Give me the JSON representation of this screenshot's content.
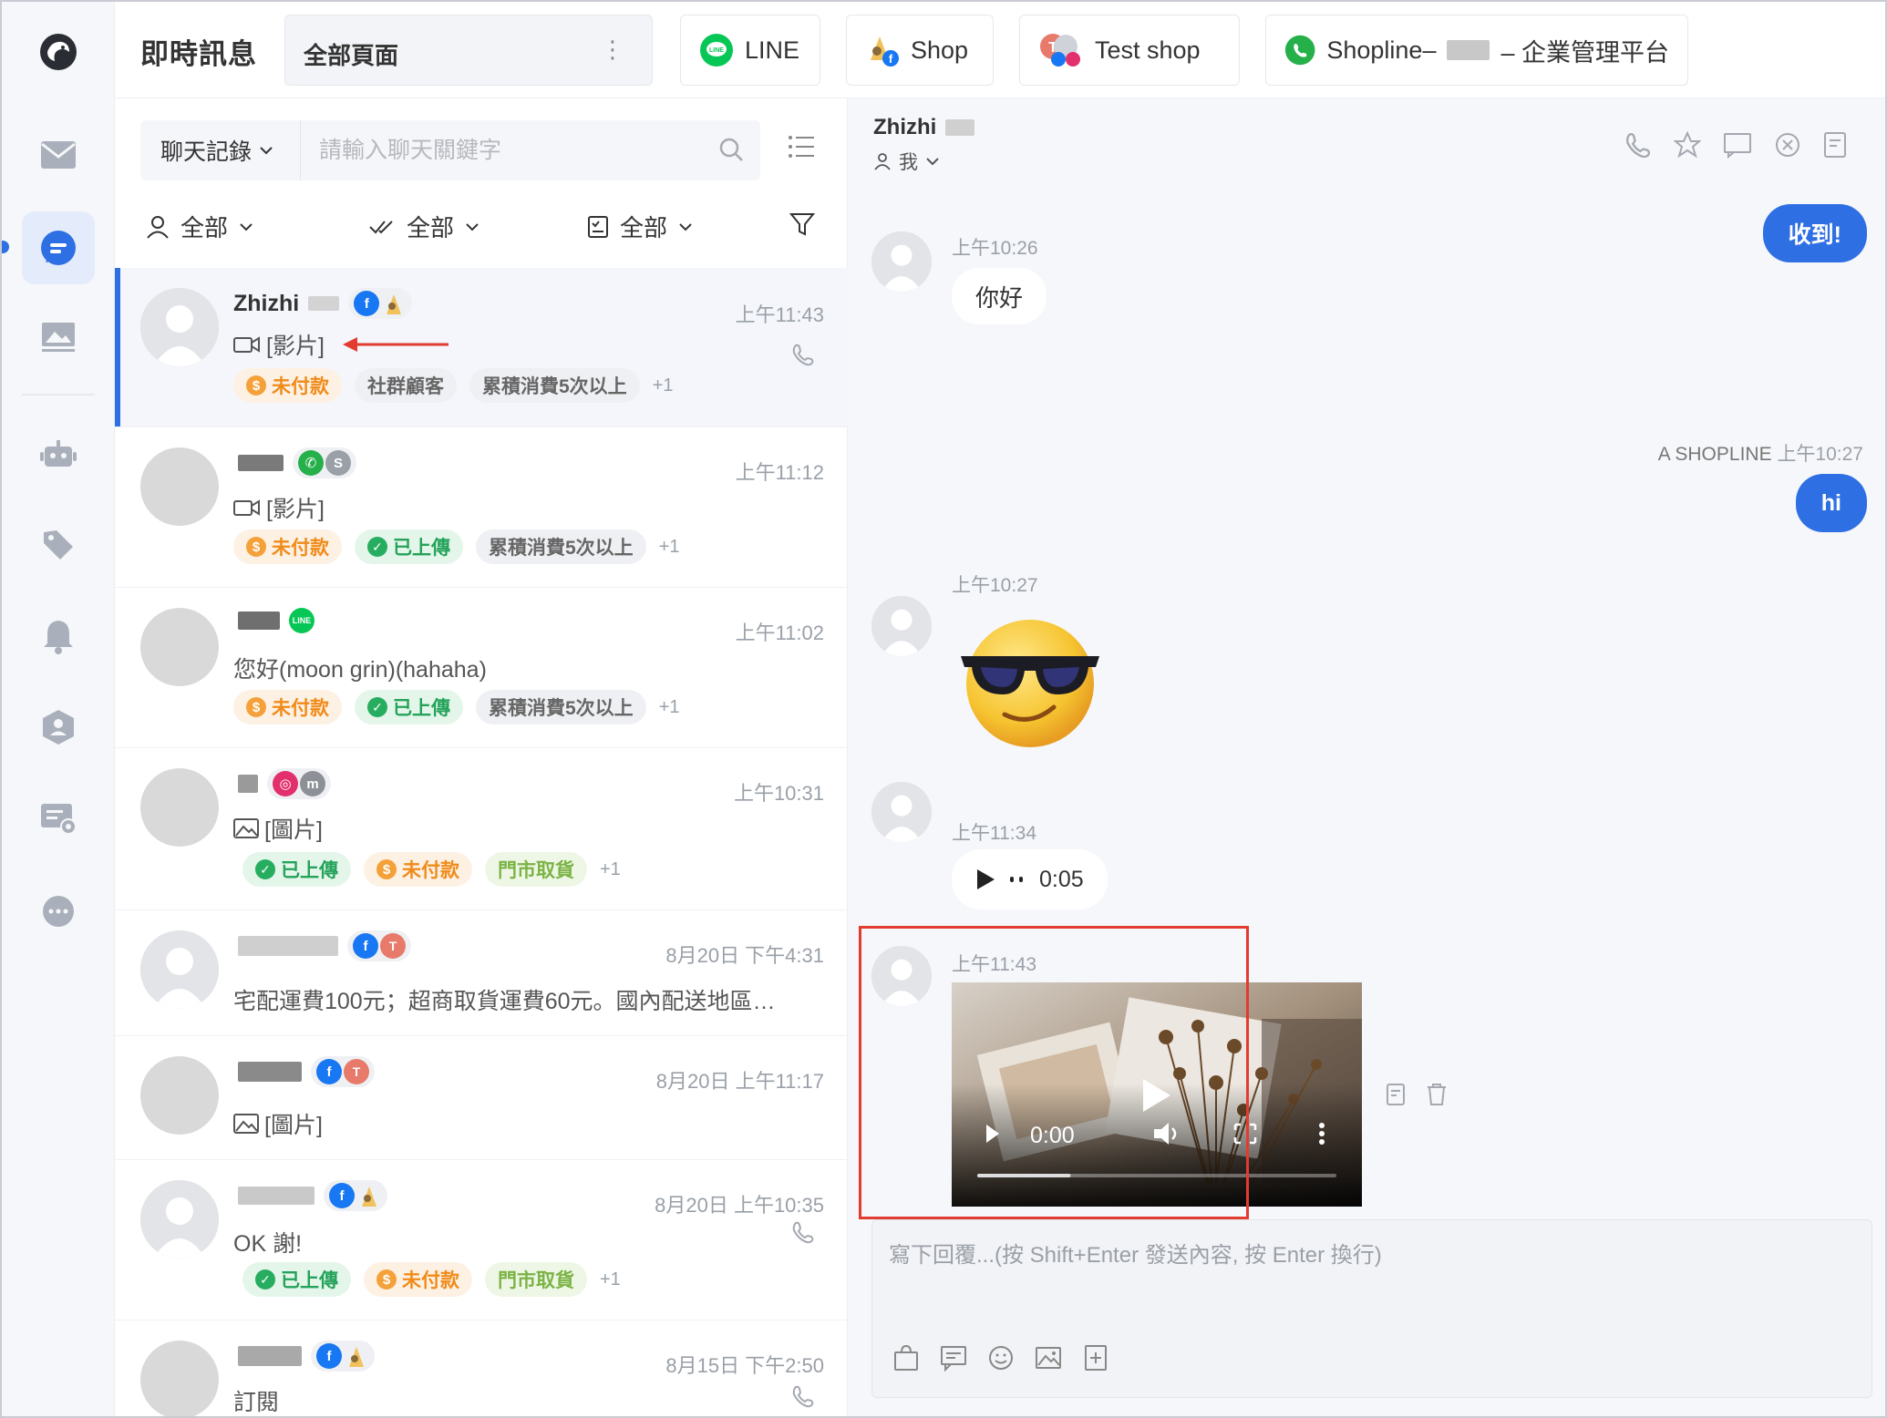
{
  "app": {
    "title": "即時訊息"
  },
  "page_selector": {
    "label": "全部頁面",
    "more": "⋮"
  },
  "channel_tabs": [
    {
      "label": "LINE"
    },
    {
      "label": "Shop"
    },
    {
      "label": "Test shop"
    },
    {
      "label_prefix": "Shopline–",
      "label_suffix": "– 企業管理平台"
    }
  ],
  "search": {
    "mode": "聊天記錄",
    "placeholder": "請輸入聊天關鍵字"
  },
  "filters": [
    {
      "label": "全部"
    },
    {
      "label": "全部"
    },
    {
      "label": "全部"
    }
  ],
  "conversations": [
    {
      "name": "Zhizhi",
      "time": "上午11:43",
      "preview": "[影片]",
      "tags": [
        "未付款",
        "社群顧客",
        "累積消費5次以上"
      ],
      "more": "+1"
    },
    {
      "name": "",
      "time": "上午11:12",
      "preview": "[影片]",
      "tags": [
        "未付款",
        "已上傳",
        "累積消費5次以上"
      ],
      "more": "+1"
    },
    {
      "name": "",
      "time": "上午11:02",
      "preview": "您好(moon grin)(hahaha)",
      "tags": [
        "未付款",
        "已上傳",
        "累積消費5次以上"
      ],
      "more": "+1"
    },
    {
      "name": "",
      "time": "上午10:31",
      "preview": "[圖片]",
      "tags": [
        "已上傳",
        "未付款",
        "門市取貨"
      ],
      "more": "+1"
    },
    {
      "name": "",
      "time": "8月20日 下午4:31",
      "preview": "宅配運費100元；超商取貨運費60元。國內配送地區…"
    },
    {
      "name": "",
      "time": "8月20日 上午11:17",
      "preview": "[圖片]"
    },
    {
      "name": "",
      "time": "8月20日 上午10:35",
      "preview": "OK 謝!",
      "tags": [
        "已上傳",
        "未付款",
        "門市取貨"
      ],
      "more": "+1"
    },
    {
      "name": "",
      "time": "8月15日 下午2:50",
      "preview": "訂閱"
    }
  ],
  "chat": {
    "contact_name": "Zhizhi",
    "assignee": "我",
    "messages": {
      "out1": "收到!",
      "in1_time": "上午10:26",
      "in1_text": "你好",
      "out2_sender": "A SHOPLINE",
      "out2_time": "上午10:27",
      "out2_text": "hi",
      "in2_time": "上午10:27",
      "in3_time": "上午11:34",
      "in3_duration": "0:05",
      "in4_time": "上午11:43",
      "in4_video_time": "0:00",
      "in4_video_progress": 0.26
    },
    "composer_placeholder": "寫下回覆...(按 Shift+Enter 發送內容, 按 Enter 換行)"
  },
  "colors": {
    "accent": "#2f6fe4",
    "unpaid": "#f08b19",
    "uploaded": "#24a35a",
    "highlight": "#e23b30"
  }
}
